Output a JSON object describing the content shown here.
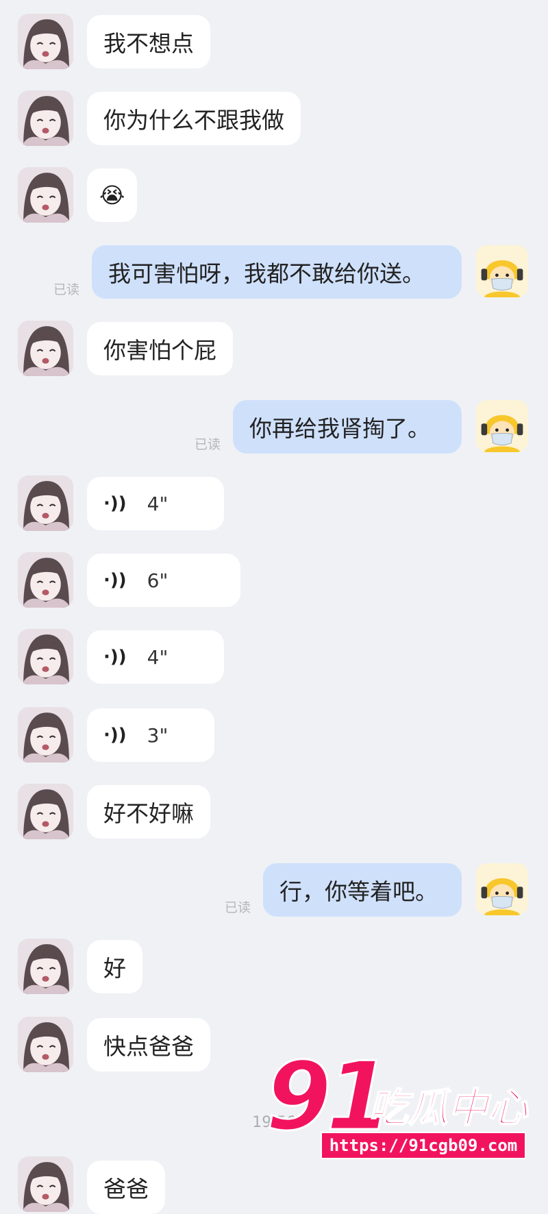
{
  "messages": [
    {
      "text": "我不想点"
    },
    {
      "text": "你为什么不跟我做"
    },
    {
      "text": "😭"
    },
    {
      "text": "我可害怕呀，我都不敢给你送。",
      "read": "已读"
    },
    {
      "text": "你害怕个屁"
    },
    {
      "text": "你再给我肾掏了。",
      "read": "已读"
    },
    {
      "icon": "voice-icon",
      "duration": "4\""
    },
    {
      "icon": "voice-icon",
      "duration": "6\""
    },
    {
      "icon": "voice-icon",
      "duration": "4\""
    },
    {
      "icon": "voice-icon",
      "duration": "3\""
    },
    {
      "text": "好不好嘛"
    },
    {
      "text": "行，你等着吧。",
      "read": "已读"
    },
    {
      "text": "好"
    },
    {
      "text": "快点爸爸"
    },
    {
      "text": "爸爸"
    }
  ],
  "timestamp": "19:56",
  "watermark": {
    "number": "91",
    "name": "吃瓜中心",
    "url": "https://91cgb09.com"
  },
  "colors": {
    "background": "#eff1f5",
    "incoming_bubble": "#ffffff",
    "outgoing_bubble": "#cfe0fb",
    "watermark": "#f2135e"
  }
}
